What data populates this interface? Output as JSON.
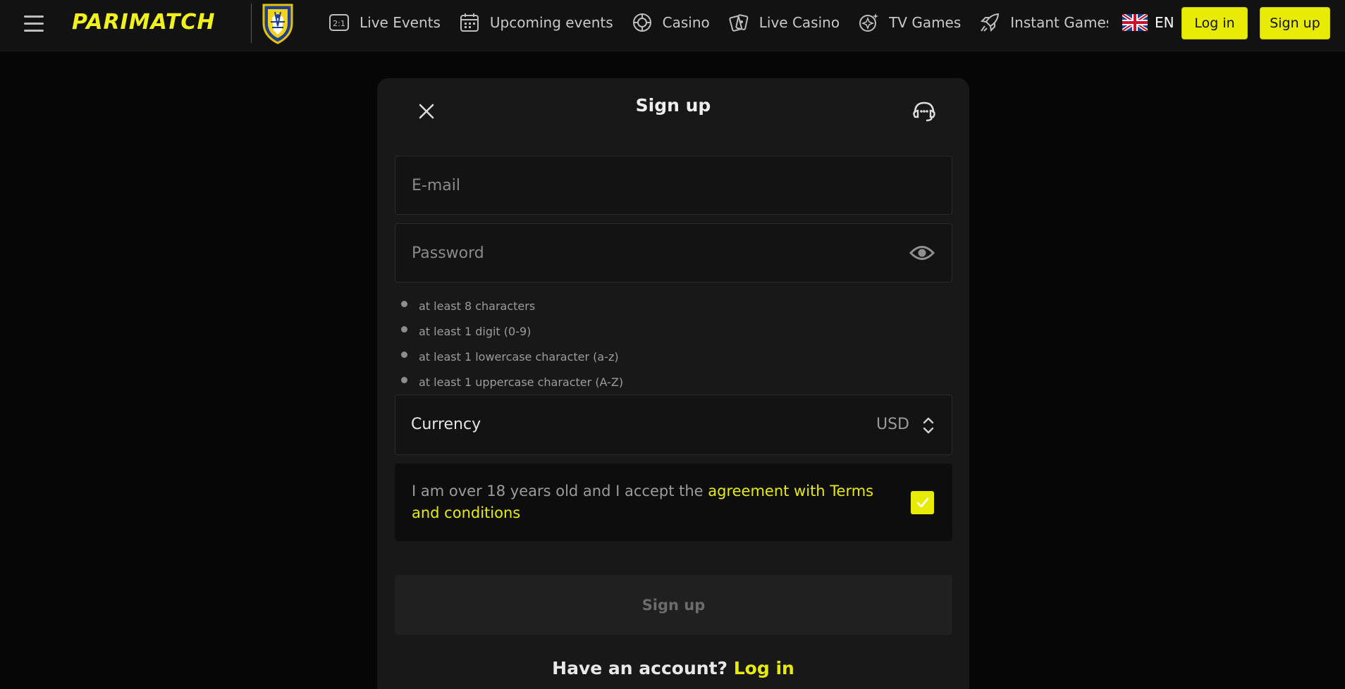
{
  "header": {
    "brand": "PARIMATCH",
    "nav": [
      {
        "label": "Live Events",
        "icon": "live-events-icon"
      },
      {
        "label": "Upcoming events",
        "icon": "calendar-icon"
      },
      {
        "label": "Casino",
        "icon": "casino-chip-icon"
      },
      {
        "label": "Live Casino",
        "icon": "cards-icon"
      },
      {
        "label": "TV Games",
        "icon": "sparkle-icon"
      },
      {
        "label": "Instant Games",
        "icon": "rocket-icon"
      }
    ],
    "live_badge": "2:1",
    "language": "EN",
    "login_label": "Log in",
    "signup_label": "Sign up"
  },
  "modal": {
    "title": "Sign up",
    "email_placeholder": "E-mail",
    "password_placeholder": "Password",
    "password_rules": [
      "at least 8 characters",
      "at least 1 digit (0-9)",
      "at least 1 lowercase character (a-z)",
      "at least 1 uppercase character (A-Z)"
    ],
    "currency_label": "Currency",
    "currency_value": "USD",
    "agree_text": "I am over 18 years old and I accept the ",
    "agree_link": "agreement with Terms and conditions",
    "agree_checked": true,
    "submit_label": "Sign up",
    "have_account": "Have an account? ",
    "login_link": "Log in"
  },
  "colors": {
    "accent": "#e8ec05",
    "background": "#060606",
    "modal": "#181818"
  }
}
